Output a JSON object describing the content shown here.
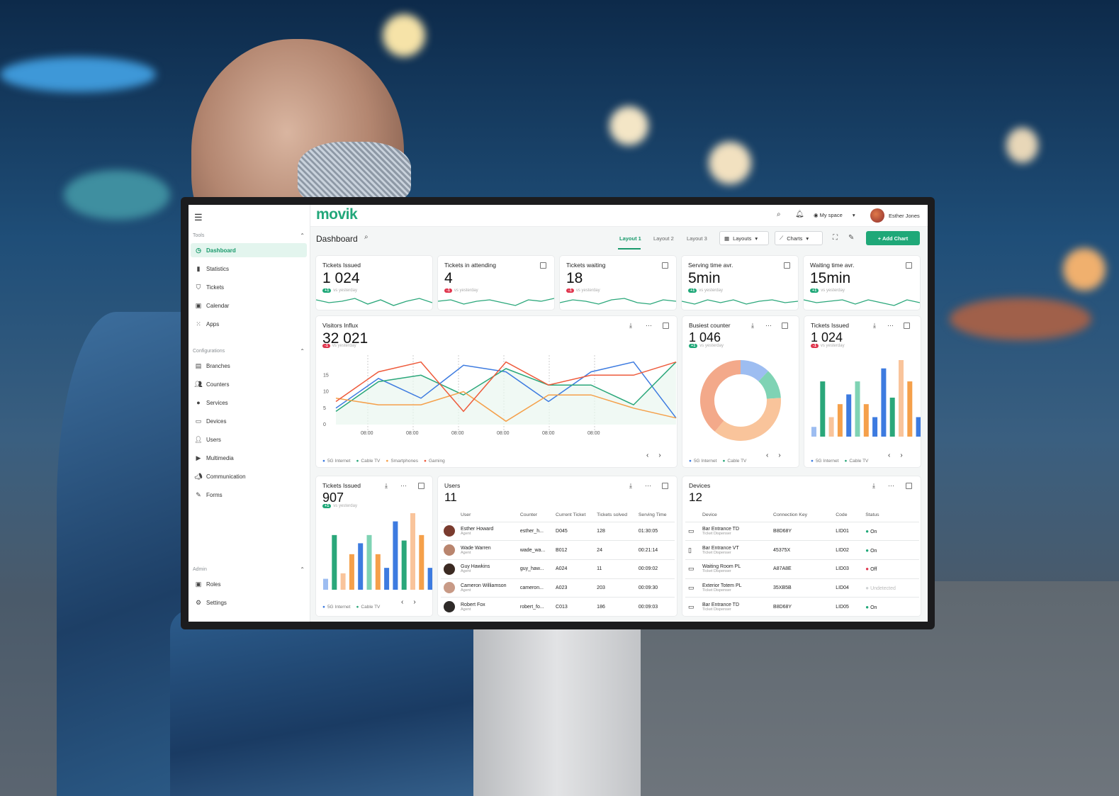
{
  "app": {
    "logo": "movik",
    "user": "Esther Jones",
    "space": "My space"
  },
  "sidebar": {
    "sections": [
      {
        "label": "Tools",
        "items": [
          {
            "label": "Dashboard",
            "icon": "dashboard-icon",
            "active": true
          },
          {
            "label": "Statistics",
            "icon": "bar-chart-icon"
          },
          {
            "label": "Tickets",
            "icon": "ticket-icon"
          },
          {
            "label": "Calendar",
            "icon": "calendar-icon"
          },
          {
            "label": "Apps",
            "icon": "apps-grid-icon"
          }
        ]
      },
      {
        "label": "Configurations",
        "items": [
          {
            "label": "Branches",
            "icon": "branch-icon"
          },
          {
            "label": "Counters",
            "icon": "counter-icon"
          },
          {
            "label": "Services",
            "icon": "services-icon"
          },
          {
            "label": "Devices",
            "icon": "devices-icon"
          },
          {
            "label": "Users",
            "icon": "users-icon"
          },
          {
            "label": "Multimedia",
            "icon": "multimedia-icon"
          },
          {
            "label": "Communication",
            "icon": "megaphone-icon"
          },
          {
            "label": "Forms",
            "icon": "forms-icon"
          }
        ]
      },
      {
        "label": "Admin",
        "items": [
          {
            "label": "Roles",
            "icon": "roles-icon"
          },
          {
            "label": "Settings",
            "icon": "settings-icon"
          }
        ]
      }
    ]
  },
  "subbar": {
    "title": "Dashboard",
    "tabs": [
      "Layout 1",
      "Layout 2",
      "Layout 3"
    ],
    "layouts": "Layouts",
    "charts": "Charts",
    "add_chart": "+ Add Chart"
  },
  "kpis": [
    {
      "title": "Tickets Issued",
      "value": "1 024",
      "delta": "+1",
      "dir": "up",
      "note": "vs yesterday"
    },
    {
      "title": "Tickets in attending",
      "value": "4",
      "delta": "-1",
      "dir": "down",
      "note": "vs yesterday"
    },
    {
      "title": "Tickets waiting",
      "value": "18",
      "delta": "-1",
      "dir": "down",
      "note": "vs yesterday"
    },
    {
      "title": "Serving time avr.",
      "value": "5min",
      "delta": "+1",
      "dir": "up",
      "note": "vs yesterday"
    },
    {
      "title": "Waiting time avr.",
      "value": "15min",
      "delta": "+1",
      "dir": "up",
      "note": "vs yesterday"
    }
  ],
  "colors": {
    "accent": "#1fa878",
    "blue": "#3d7be0",
    "green": "#2aa77a",
    "orange": "#f5a04a",
    "red": "#ee5b3c",
    "teal": "#7fd3b4",
    "peach": "#f9c49b",
    "lightblue": "#9dbdf1"
  },
  "visitors": {
    "title": "Visitors Influx",
    "value": "32 021",
    "delta": "-1",
    "note": "vs yesterday",
    "legend": [
      "5G Internet",
      "Cable TV",
      "Smartphones",
      "Gaming"
    ]
  },
  "busiest": {
    "title": "Busiest counter",
    "value": "1 046",
    "delta": "+1",
    "note": "vs yesterday",
    "legend": [
      "5G Internet",
      "Cable TV"
    ]
  },
  "issued_small": {
    "title": "Tickets Issued",
    "value": "1 024",
    "delta": "-1",
    "note": "vs yesterday",
    "legend": [
      "5G Internet",
      "Cable TV"
    ]
  },
  "issued_bottom": {
    "title": "Tickets Issued",
    "value": "907",
    "delta": "+1",
    "note": "vs yesterday",
    "legend": [
      "5G Internet",
      "Cable TV"
    ]
  },
  "users": {
    "title": "Users",
    "count": "11",
    "columns": [
      "User",
      "Counter",
      "Current Ticket",
      "Tickets solved",
      "Serving Time"
    ],
    "rows": [
      {
        "name": "Esther Howard",
        "role": "Agent",
        "counter": "esther_h...",
        "ticket": "D045",
        "solved": "128",
        "time": "01:30:05"
      },
      {
        "name": "Wade Warren",
        "role": "Agent",
        "counter": "wade_wa...",
        "ticket": "B012",
        "solved": "24",
        "time": "00:21:14"
      },
      {
        "name": "Guy Hawkins",
        "role": "Agent",
        "counter": "guy_haw...",
        "ticket": "A024",
        "solved": "11",
        "time": "00:09:02"
      },
      {
        "name": "Cameron Williamson",
        "role": "Agent",
        "counter": "cameron...",
        "ticket": "A023",
        "solved": "203",
        "time": "00:09:30"
      },
      {
        "name": "Robert Fox",
        "role": "Agent",
        "counter": "robert_fo...",
        "ticket": "C013",
        "solved": "186",
        "time": "00:09:03"
      }
    ]
  },
  "devices": {
    "title": "Devices",
    "count": "12",
    "columns": [
      "Device",
      "Connection Key",
      "Code",
      "Status"
    ],
    "rows": [
      {
        "name": "Bar Entrance TD",
        "type": "Ticket Dispenser",
        "key": "B8D68Y",
        "code": "LID01",
        "status": "On",
        "state": "on"
      },
      {
        "name": "Bar Entrance VT",
        "type": "Ticket Dispenser",
        "key": "45375X",
        "code": "LID02",
        "status": "On",
        "state": "on"
      },
      {
        "name": "Waiting Room PL",
        "type": "Ticket Dispenser",
        "key": "A87A8E",
        "code": "LID03",
        "status": "Off",
        "state": "off"
      },
      {
        "name": "Exterior Totem PL",
        "type": "Ticket Dispenser",
        "key": "35XB5B",
        "code": "LID04",
        "status": "Undetected",
        "state": "undetected"
      },
      {
        "name": "Bar Entrance TD",
        "type": "Ticket Dispenser",
        "key": "B8D68Y",
        "code": "LID05",
        "status": "On",
        "state": "on"
      }
    ]
  },
  "chart_data": [
    {
      "type": "line",
      "title": "Visitors Influx",
      "x": [
        "08:00",
        "08:00",
        "08:00",
        "08:00",
        "08:00",
        "08:00"
      ],
      "ylim": [
        0,
        20
      ],
      "yticks": [
        0,
        5,
        10,
        15
      ],
      "series": [
        {
          "name": "5G Internet",
          "values": [
            5,
            14,
            8,
            18,
            16,
            7,
            16,
            19,
            2
          ]
        },
        {
          "name": "Cable TV",
          "values": [
            4,
            13,
            15,
            9,
            17,
            12,
            12,
            6,
            19
          ]
        },
        {
          "name": "Smartphones",
          "values": [
            8,
            6,
            6,
            10,
            1,
            9,
            9,
            5,
            2
          ]
        },
        {
          "name": "Gaming",
          "values": [
            7,
            16,
            19,
            4,
            19,
            12,
            15,
            15,
            19
          ]
        }
      ]
    },
    {
      "type": "pie",
      "title": "Busiest counter",
      "slices": [
        {
          "name": "Blue",
          "value": 12
        },
        {
          "name": "Teal",
          "value": 12
        },
        {
          "name": "Peach",
          "value": 37
        },
        {
          "name": "Orange",
          "value": 39
        }
      ]
    },
    {
      "type": "bar",
      "title": "Tickets Issued",
      "values": [
        3,
        17,
        6,
        10,
        13,
        17,
        10,
        6,
        21,
        12,
        24,
        17,
        6
      ],
      "colors": [
        "lightblue",
        "green",
        "peach",
        "orange",
        "blue",
        "teal",
        "orange",
        "blue",
        "blue",
        "green",
        "peach",
        "orange",
        "blue"
      ]
    },
    {
      "type": "bar",
      "title": "Tickets Issued",
      "values": [
        4,
        20,
        6,
        13,
        17,
        20,
        13,
        8,
        25,
        18,
        28,
        20,
        8
      ],
      "colors": [
        "lightblue",
        "green",
        "peach",
        "orange",
        "blue",
        "teal",
        "orange",
        "blue",
        "blue",
        "green",
        "peach",
        "orange",
        "blue"
      ]
    }
  ]
}
